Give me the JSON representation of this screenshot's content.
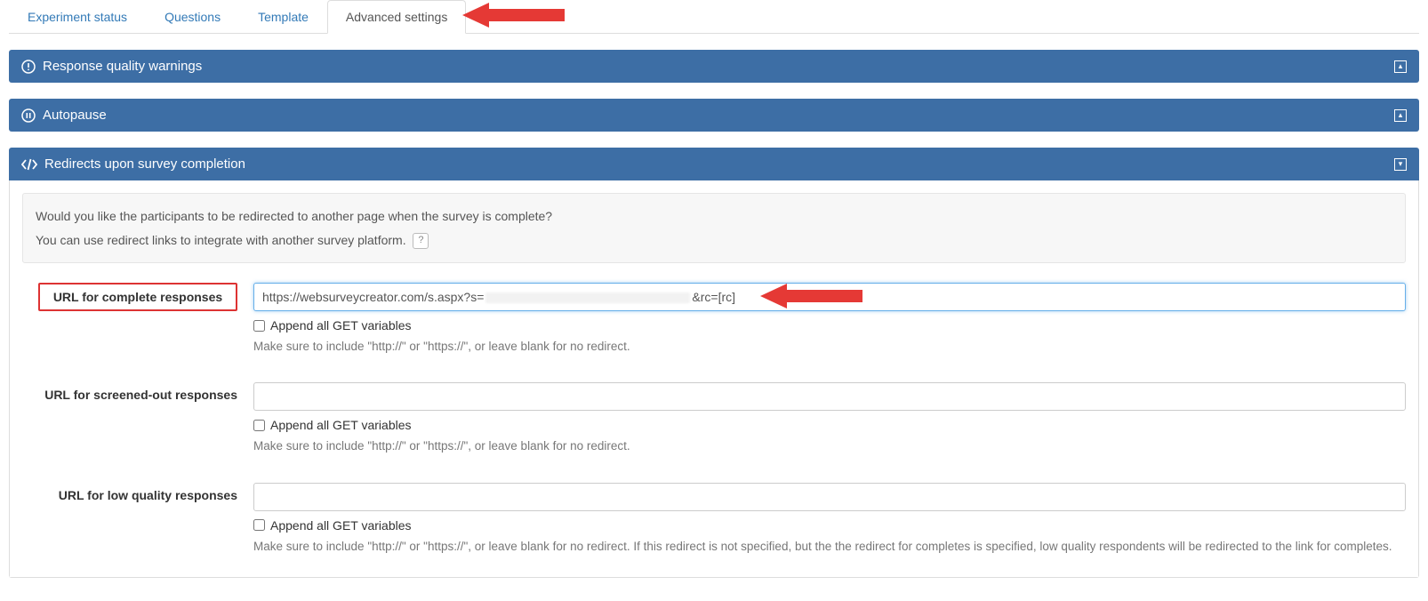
{
  "tabs": {
    "items": [
      {
        "label": "Experiment status"
      },
      {
        "label": "Questions"
      },
      {
        "label": "Template"
      },
      {
        "label": "Advanced settings"
      }
    ],
    "activeIndex": 3
  },
  "panels": {
    "quality": {
      "title": "Response quality warnings",
      "toggle": "▴"
    },
    "autopause": {
      "title": "Autopause",
      "toggle": "▴"
    },
    "redirects": {
      "title": "Redirects upon survey completion",
      "toggle": "▾"
    }
  },
  "redirects": {
    "info_line1": "Would you like the participants to be redirected to another page when the survey is complete?",
    "info_line2": "You can use redirect links to integrate with another survey platform.",
    "help_symbol": "?",
    "fields": {
      "complete": {
        "label": "URL for complete responses",
        "value_prefix": "https://websurveycreator.com/s.aspx?s=",
        "value_suffix": "&rc=[rc]",
        "append_label": "Append all GET variables",
        "hint": "Make sure to include \"http://\" or \"https://\", or leave blank for no redirect."
      },
      "screened": {
        "label": "URL for screened-out responses",
        "value": "",
        "append_label": "Append all GET variables",
        "hint": "Make sure to include \"http://\" or \"https://\", or leave blank for no redirect."
      },
      "lowquality": {
        "label": "URL for low quality responses",
        "value": "",
        "append_label": "Append all GET variables",
        "hint": "Make sure to include \"http://\" or \"https://\", or leave blank for no redirect. If this redirect is not specified, but the the redirect for completes is specified, low quality respondents will be redirected to the link for completes."
      }
    }
  }
}
